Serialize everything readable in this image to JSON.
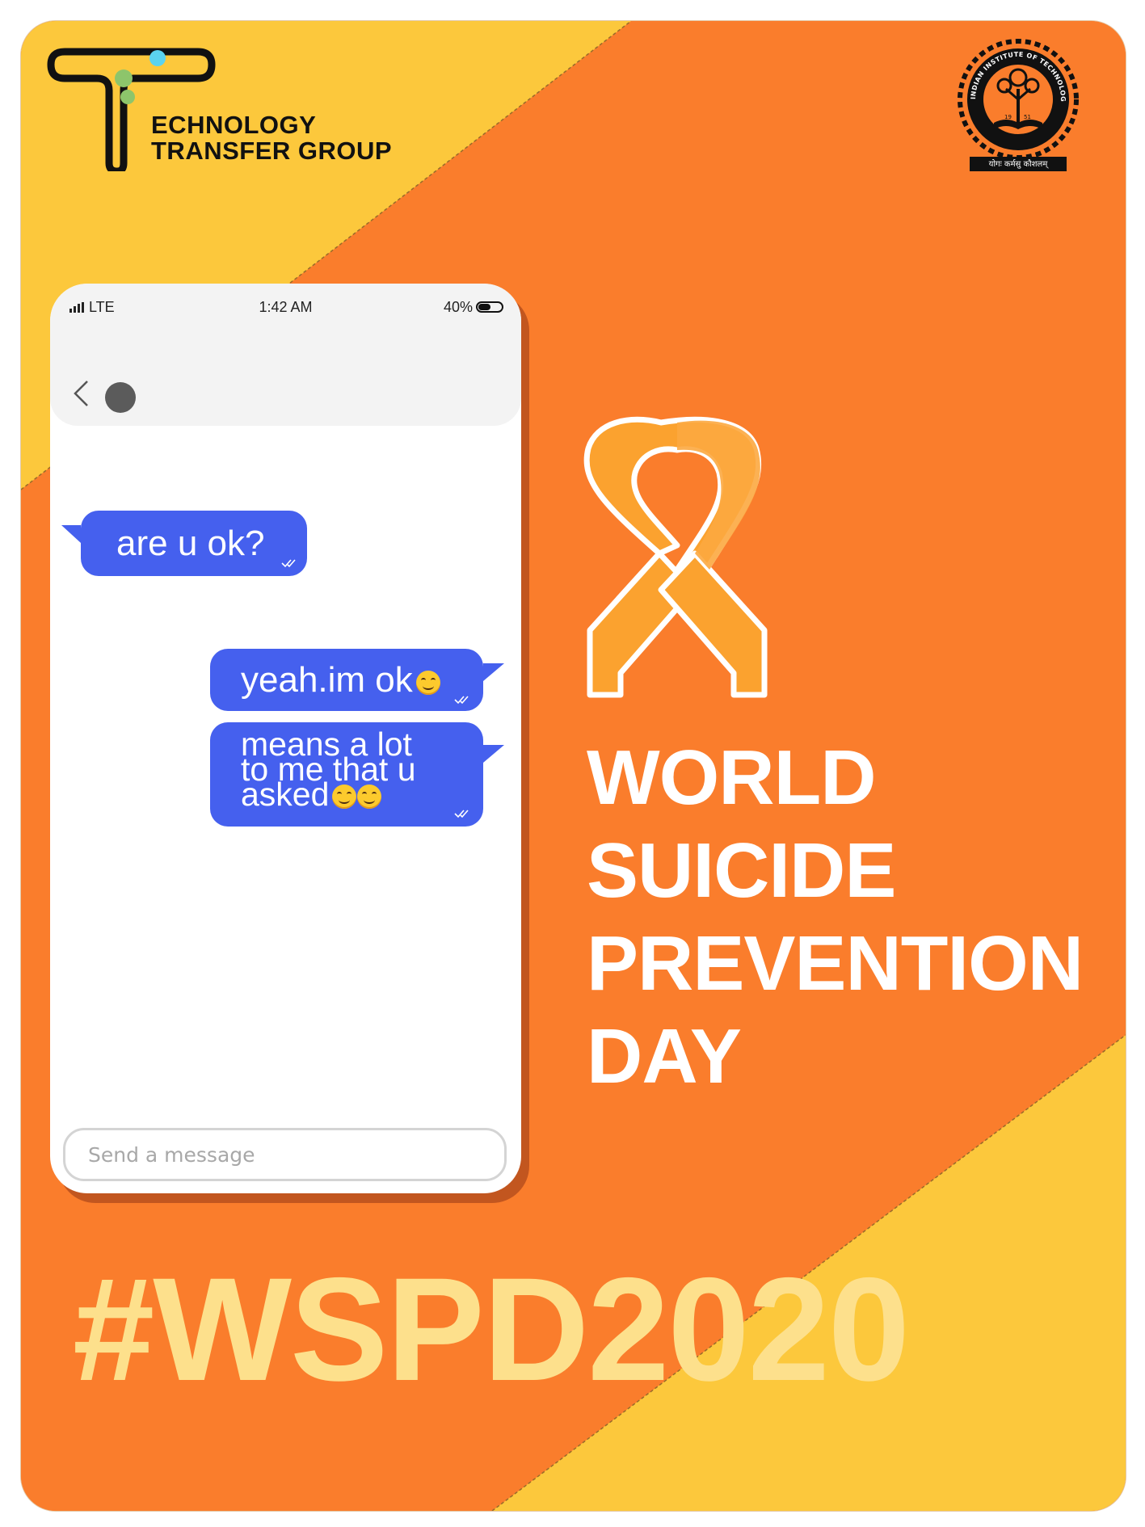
{
  "logo": {
    "line1": "ECHNOLOGY",
    "line2": "TRANSFER GROUP"
  },
  "seal": {
    "top_text": "INDIAN INSTITUTE OF TECHNOLOGY KHARAGPUR",
    "year_left": "19",
    "year_right": "51",
    "motto": "योगः कर्मसु कौशलम्"
  },
  "phone": {
    "status": {
      "signal": "LTE",
      "time": "1:42 AM",
      "battery": "40%"
    },
    "messages": [
      {
        "side": "received",
        "text": "are u ok?"
      },
      {
        "side": "sent",
        "text": "yeah.im ok",
        "emoji_count": 1
      },
      {
        "side": "sent",
        "lines": [
          "means a lot",
          "to me that u",
          "asked"
        ],
        "emoji_count": 2
      }
    ],
    "composer": {
      "placeholder": "Send a message"
    }
  },
  "title_lines": [
    "WORLD",
    "SUICIDE",
    "PREVENTION",
    "DAY"
  ],
  "hashtag": "#WSPD2020",
  "colors": {
    "orange": "#fa7d2c",
    "yellow": "#fcc83c",
    "bubble_blue": "#4560ee",
    "ribbon_orange": "#fba22f",
    "hashtag": "#fde08c"
  },
  "icons": [
    "signal-icon",
    "battery-icon",
    "back-icon",
    "avatar",
    "checkmark-icon",
    "smile-emoji-icon",
    "awareness-ribbon-icon"
  ]
}
